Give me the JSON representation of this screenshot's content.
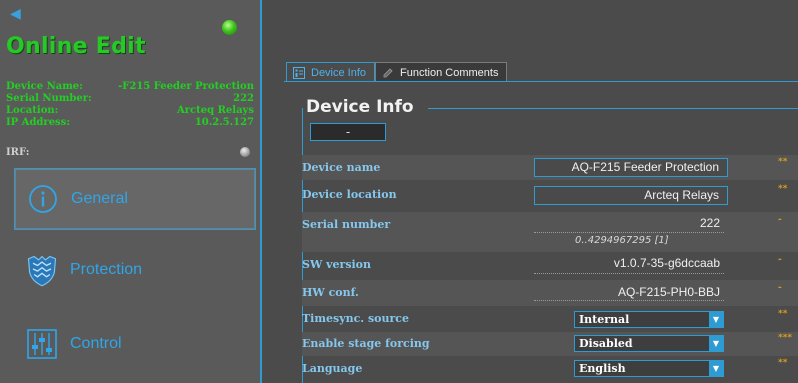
{
  "status": {
    "title": "Online Edit",
    "rows": [
      {
        "label": "Device Name:",
        "value": "-F215 Feeder Protection"
      },
      {
        "label": "Serial Number:",
        "value": "222"
      },
      {
        "label": "Location:",
        "value": "Arcteq Relays"
      },
      {
        "label": "IP Address:",
        "value": "10.2.5.127"
      }
    ],
    "irf_label": "IRF:"
  },
  "nav": {
    "general": "General",
    "protection": "Protection",
    "control": "Control"
  },
  "tabs": {
    "device_info": "Device Info",
    "function_comments": "Function Comments"
  },
  "section": {
    "title": "Device Info",
    "collapse_label": "-"
  },
  "fields": {
    "device_name": {
      "label": "Device name",
      "value": "AQ-F215 Feeder Protection",
      "marker": "**"
    },
    "device_location": {
      "label": "Device location",
      "value": "Arcteq Relays",
      "marker": "**"
    },
    "serial_number": {
      "label": "Serial number",
      "value": "222",
      "range": "0..4294967295 [1]",
      "marker": "-"
    },
    "sw_version": {
      "label": "SW version",
      "value": "v1.0.7-35-g6dccaab",
      "marker": "-"
    },
    "hw_conf": {
      "label": "HW conf.",
      "value": "AQ-F215-PH0-BBJ",
      "marker": "-"
    },
    "timesync_source": {
      "label": "Timesync. source",
      "value": "Internal",
      "marker": "**"
    },
    "enable_stage_forcing": {
      "label": "Enable stage forcing",
      "value": "Disabled",
      "marker": "***"
    },
    "language": {
      "label": "Language",
      "value": "English",
      "marker": "**"
    }
  },
  "colors": {
    "accent": "#2f9bd3",
    "status_green": "#27c927",
    "label_blue": "#86c7ee",
    "marker_orange": "#d89a22",
    "background": "#4b4b4b"
  },
  "icons": {
    "back": "back-arrow-icon",
    "online_led": "green-led-icon",
    "irf_led": "grey-led-icon",
    "general": "info-circle-icon",
    "protection": "shield-icon",
    "control": "sliders-icon",
    "dropdown": "chevron-down-icon"
  }
}
